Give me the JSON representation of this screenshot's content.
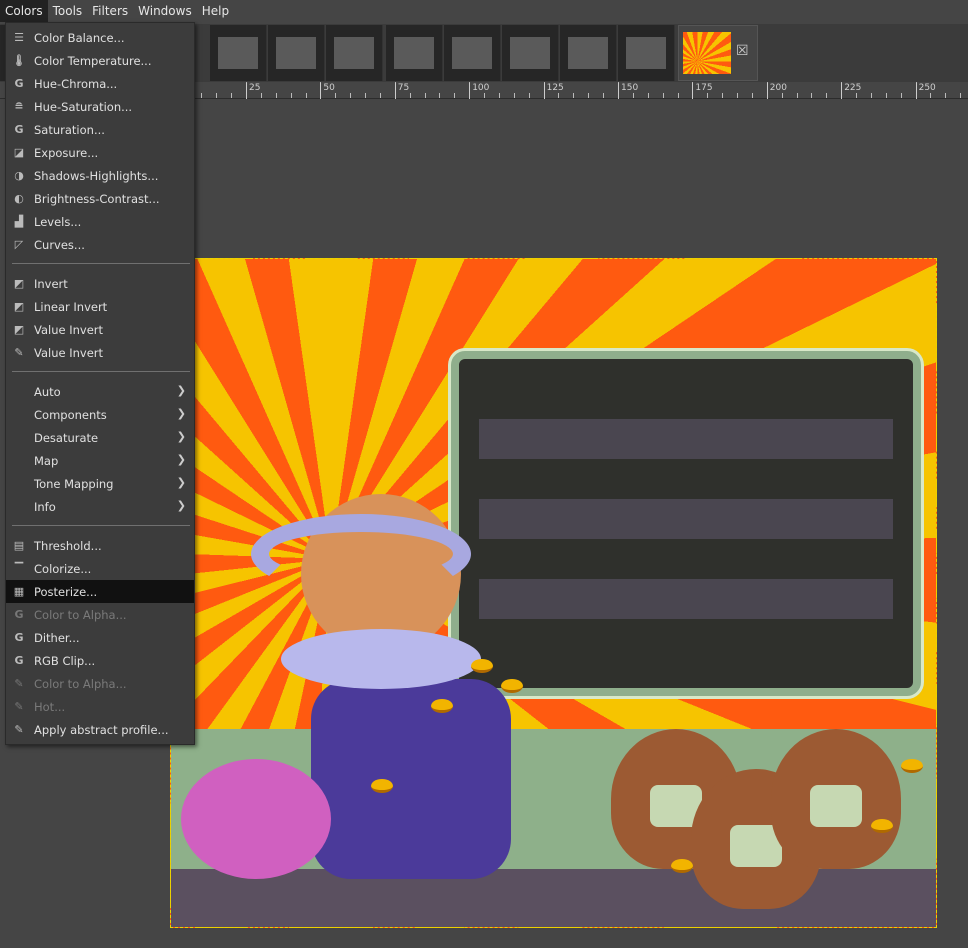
{
  "menubar": {
    "items": [
      "Colors",
      "Tools",
      "Filters",
      "Windows",
      "Help"
    ],
    "active": "Colors"
  },
  "ruler": {
    "labels": [
      "25",
      "50",
      "75",
      "100",
      "125",
      "150",
      "175",
      "200",
      "225",
      "250"
    ]
  },
  "tabs": {
    "close_icon": "close-box-icon"
  },
  "menu": {
    "groups": [
      [
        {
          "label": "Color Balance...",
          "icon": "color-balance-icon"
        },
        {
          "label": "Color Temperature...",
          "icon": "thermometer-icon"
        },
        {
          "label": "Hue-Chroma...",
          "icon": "gegl-icon"
        },
        {
          "label": "Hue-Saturation...",
          "icon": "hue-saturation-icon"
        },
        {
          "label": "Saturation...",
          "icon": "gegl-icon"
        },
        {
          "label": "Exposure...",
          "icon": "exposure-icon"
        },
        {
          "label": "Shadows-Highlights...",
          "icon": "shadows-highlights-icon"
        },
        {
          "label": "Brightness-Contrast...",
          "icon": "brightness-contrast-icon"
        },
        {
          "label": "Levels...",
          "icon": "levels-icon"
        },
        {
          "label": "Curves...",
          "icon": "curves-icon"
        }
      ],
      [
        {
          "label": "Invert",
          "icon": "invert-icon"
        },
        {
          "label": "Linear Invert",
          "icon": "invert-icon"
        },
        {
          "label": "Value Invert",
          "icon": "invert-icon"
        },
        {
          "label": "Value Invert",
          "icon": "plugin-icon"
        }
      ],
      [
        {
          "label": "Auto",
          "submenu": true
        },
        {
          "label": "Components",
          "submenu": true
        },
        {
          "label": "Desaturate",
          "submenu": true
        },
        {
          "label": "Map",
          "submenu": true
        },
        {
          "label": "Tone Mapping",
          "submenu": true
        },
        {
          "label": "Info",
          "submenu": true
        }
      ],
      [
        {
          "label": "Threshold...",
          "icon": "threshold-icon"
        },
        {
          "label": "Colorize...",
          "icon": "colorize-icon"
        },
        {
          "label": "Posterize...",
          "icon": "posterize-icon",
          "selected": true
        },
        {
          "label": "Color to Alpha...",
          "icon": "gegl-icon",
          "disabled": true
        },
        {
          "label": "Dither...",
          "icon": "gegl-icon"
        },
        {
          "label": "RGB Clip...",
          "icon": "gegl-icon"
        },
        {
          "label": "Color to Alpha...",
          "icon": "plugin-icon",
          "disabled": true
        },
        {
          "label": "Hot...",
          "icon": "plugin-icon",
          "disabled": true
        },
        {
          "label": "Apply abstract profile...",
          "icon": "plugin-icon"
        }
      ]
    ]
  },
  "colors": {
    "menu_bg": "#3c3c3c",
    "selected": "#111111",
    "canvas_bg": "#454545",
    "sun_yellow": "#f6c400",
    "sun_orange": "#ff5a10"
  }
}
